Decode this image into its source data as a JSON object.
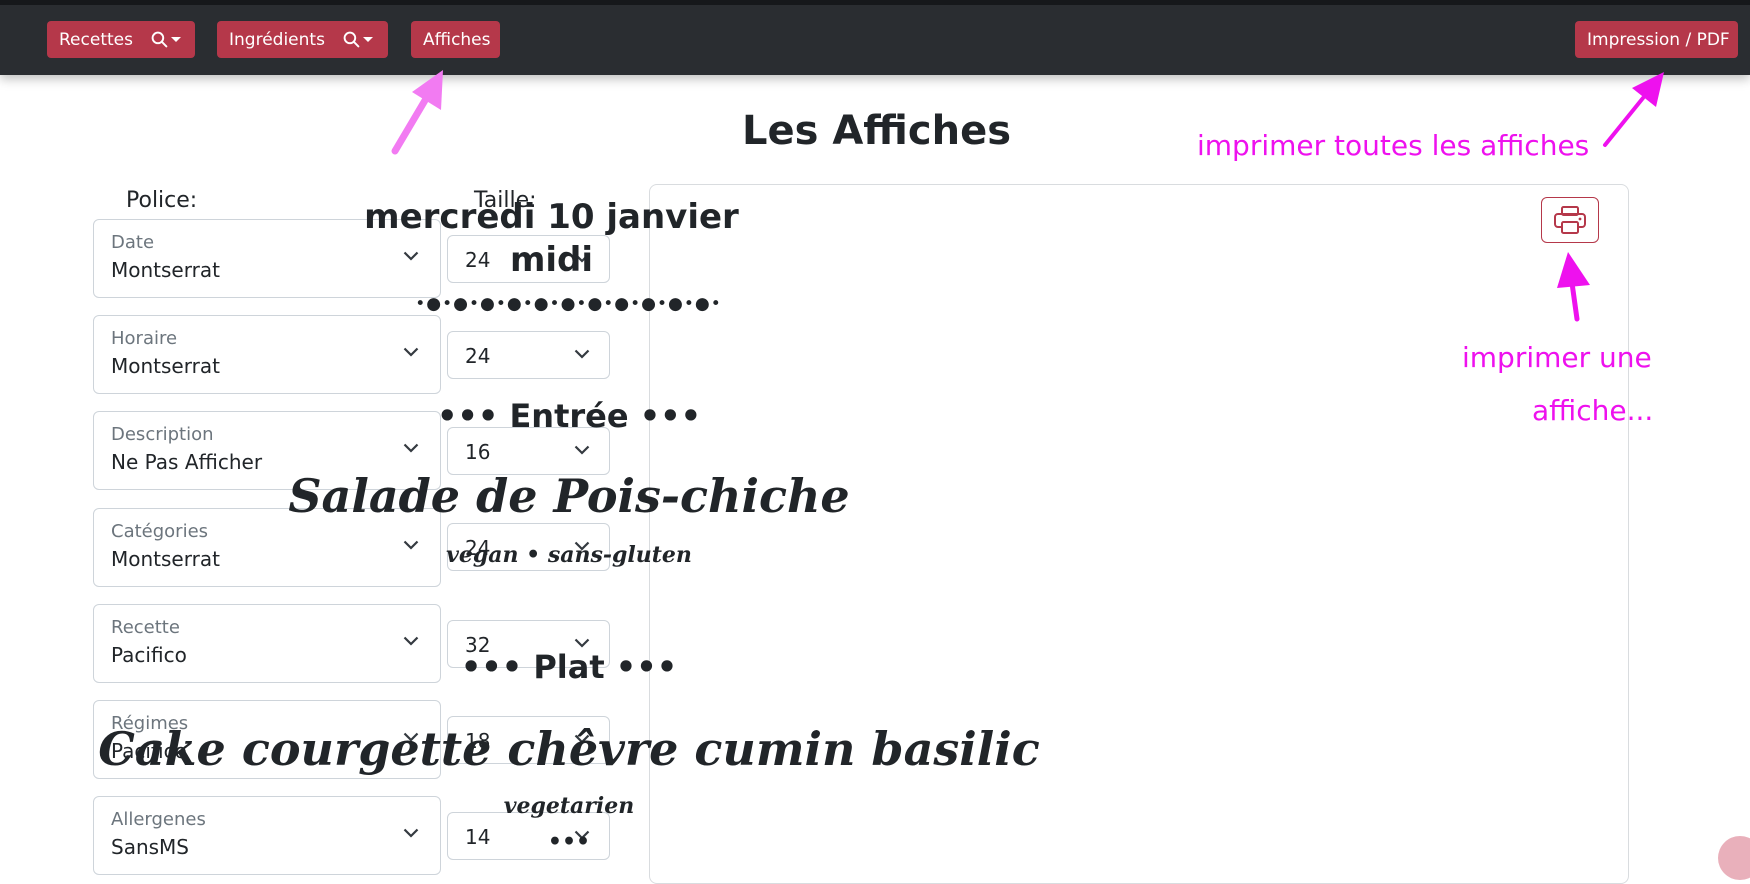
{
  "navbar": {
    "recettes_label": "Recettes",
    "ingredients_label": "Ingrédients",
    "affiches_label": "Affiches",
    "print_label": "Impression / PDF"
  },
  "page": {
    "title": "Les Affiches"
  },
  "controls": {
    "police_header": "Police:",
    "taille_header": "Taille:",
    "rows": [
      {
        "label": "Date",
        "font": "Montserrat",
        "size": "24"
      },
      {
        "label": "Horaire",
        "font": "Montserrat",
        "size": "24"
      },
      {
        "label": "Description",
        "font": "Ne Pas Afficher",
        "size": "16"
      },
      {
        "label": "Catégories",
        "font": "Montserrat",
        "size": "24"
      },
      {
        "label": "Recette",
        "font": "Pacifico",
        "size": "32"
      },
      {
        "label": "Régimes",
        "font": "Pacifico",
        "size": "18"
      },
      {
        "label": "Allergenes",
        "font": "SansMS",
        "size": "14"
      }
    ]
  },
  "poster": {
    "date": "mercredi 10 janvier",
    "time": "midi",
    "divider": "•●•●•●•●•●•●•●•●•●•●•●•",
    "sections": [
      {
        "category": "••• Entrée •••",
        "recipe": "Salade de Pois-chiche",
        "regimes": "vegan • sans-gluten"
      },
      {
        "category": "••• Plat •••",
        "recipe": "Cake courgette chêvre cumin basilic",
        "regimes": "vegetarien"
      }
    ],
    "more": "•••"
  },
  "annotations": {
    "print_all": "imprimer toutes les affiches",
    "print_one_line1": "imprimer une",
    "print_one_line2": "affiche..."
  },
  "colors": {
    "navbar_bg": "#2a2d31",
    "button_bg": "#b5384a",
    "annotation": "#ee11ee"
  },
  "icons": [
    "search-icon",
    "caret-down-icon",
    "chevron-down-icon",
    "printer-icon",
    "arrow-icon"
  ]
}
